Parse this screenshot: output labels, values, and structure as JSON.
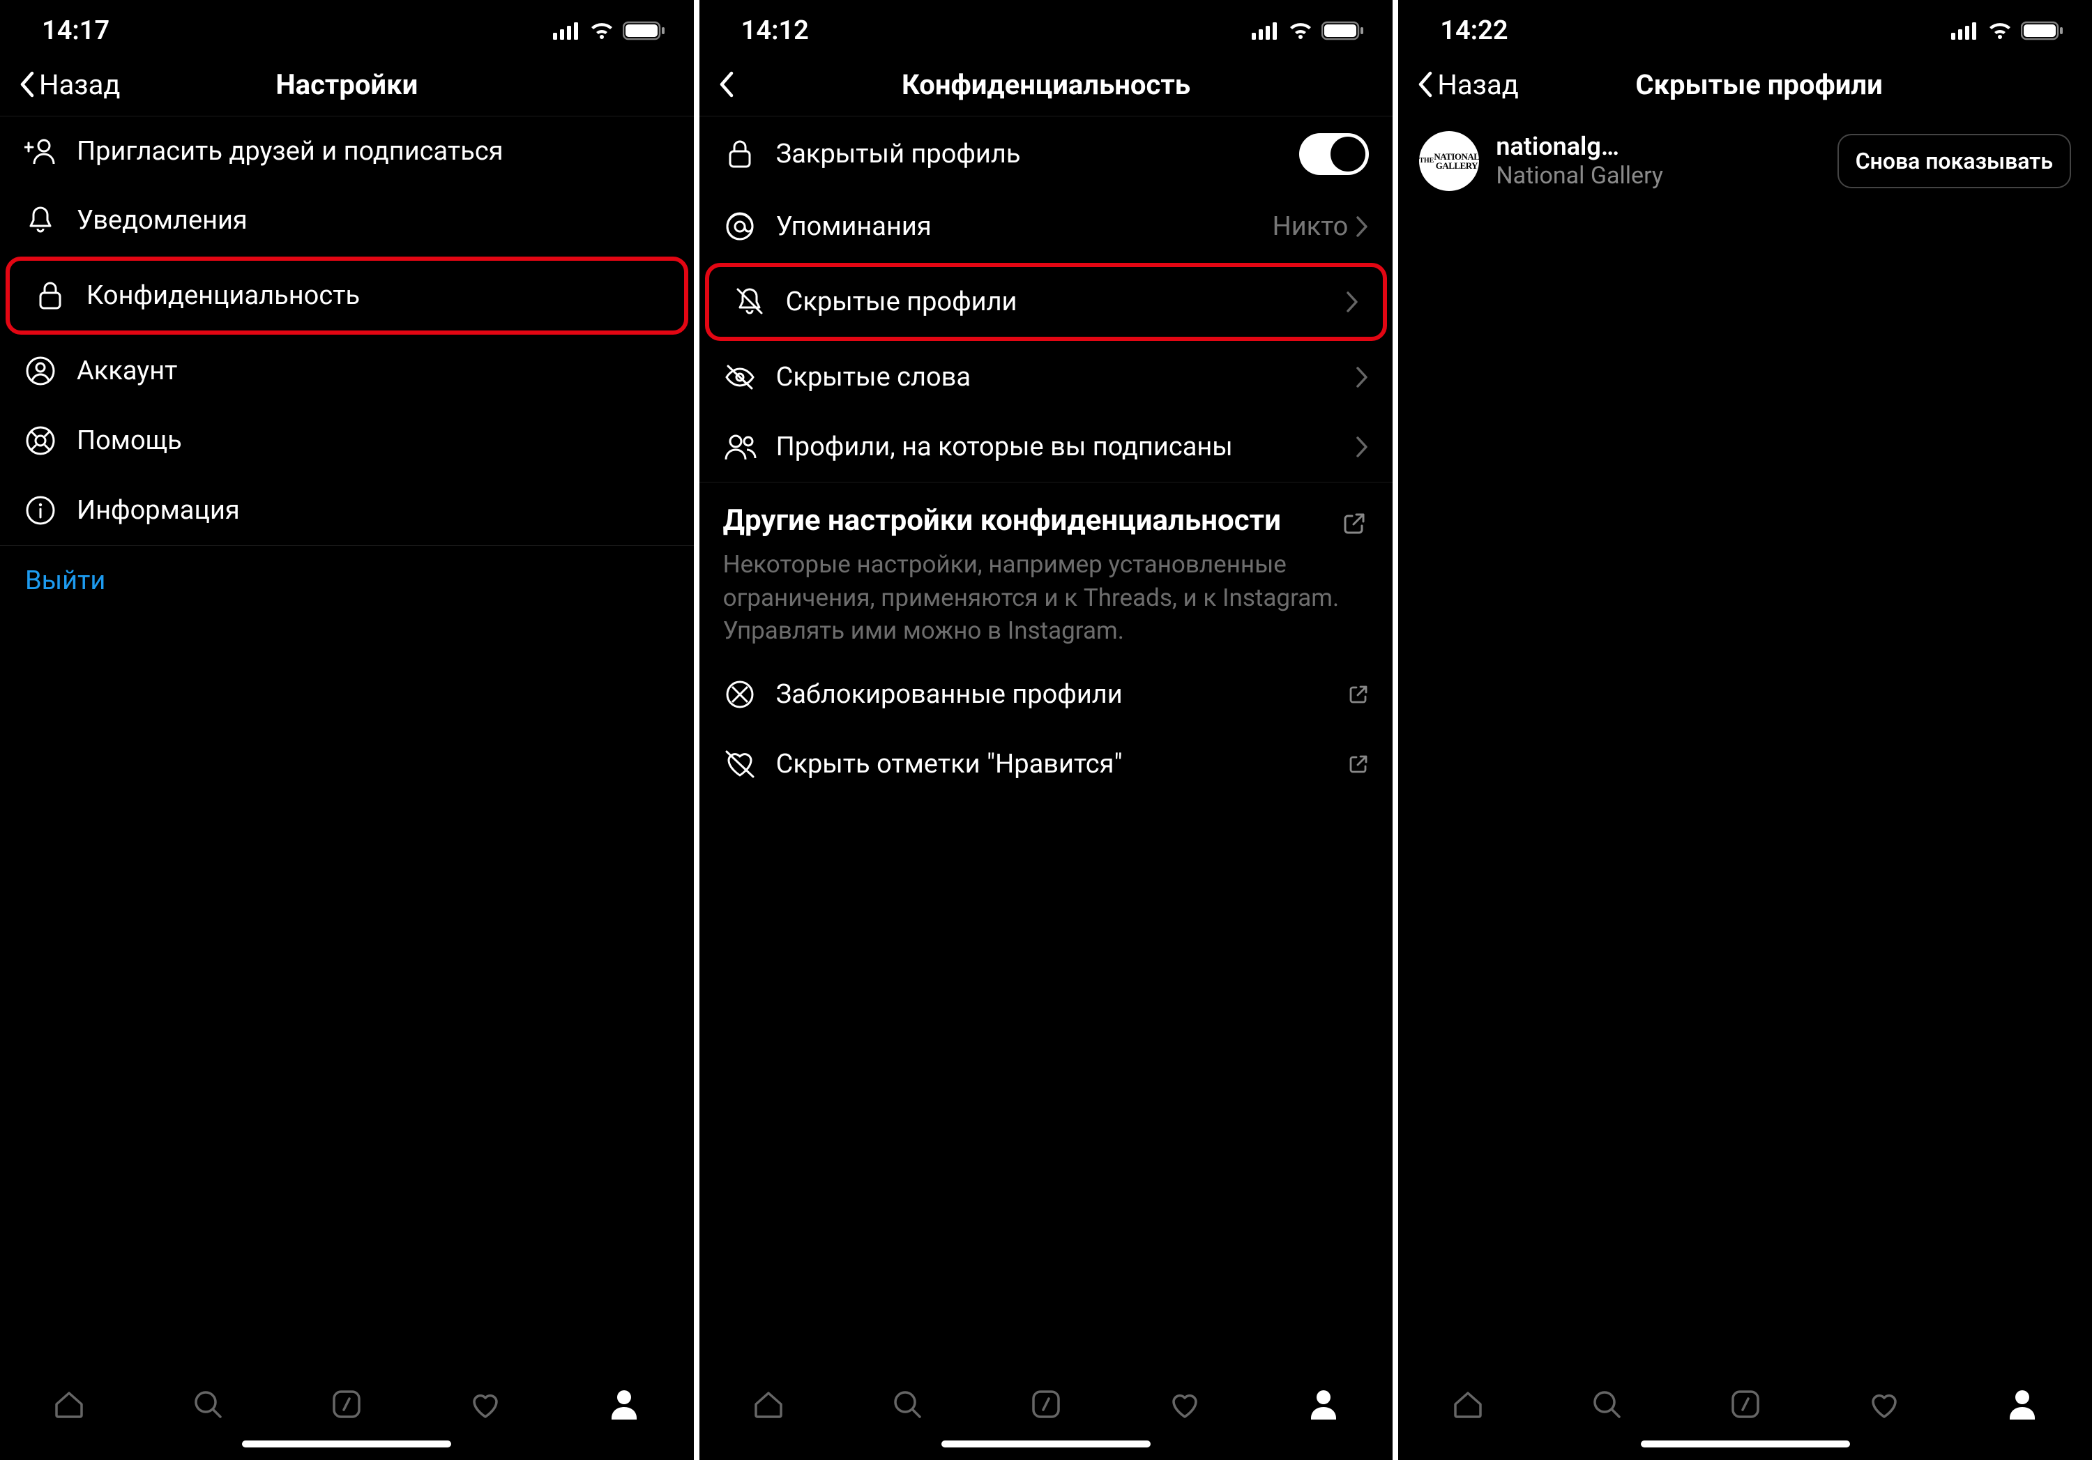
{
  "colors": {
    "accent": "#1d9bf0",
    "highlight": "#e30613",
    "muted": "#6d6d6d"
  },
  "screen1": {
    "status_time": "14:17",
    "back_label": "Назад",
    "title": "Настройки",
    "items": [
      {
        "label": "Пригласить друзей и подписаться",
        "icon": "add-user"
      },
      {
        "label": "Уведомления",
        "icon": "bell"
      },
      {
        "label": "Конфиденциальность",
        "icon": "lock",
        "highlight": true
      },
      {
        "label": "Аккаунт",
        "icon": "user-circle"
      },
      {
        "label": "Помощь",
        "icon": "life-ring"
      },
      {
        "label": "Информация",
        "icon": "info"
      }
    ],
    "logout": "Выйти"
  },
  "screen2": {
    "status_time": "14:12",
    "title": "Конфиденциальность",
    "rows": {
      "private_profile": "Закрытый профиль",
      "mentions": {
        "label": "Упоминания",
        "value": "Никто"
      },
      "hidden_profiles": "Скрытые профили",
      "hidden_words": "Скрытые слова",
      "profiles_followed": "Профили, на которые вы подписаны"
    },
    "section": {
      "title": "Другие настройки конфиденциальности",
      "desc": "Некоторые настройки, например установленные ограничения, применяются и к Threads, и к Instagram. Управлять ими можно в Instagram."
    },
    "extra_rows": {
      "blocked": "Заблокированные профили",
      "hide_likes": "Скрыть отметки \"Нравится\""
    }
  },
  "screen3": {
    "status_time": "14:22",
    "back_label": "Назад",
    "title": "Скрытые профили",
    "profile": {
      "username": "nationalg…",
      "fullname": "National Gallery",
      "avatar_text": "THE NATIONAL GALLERY",
      "action": "Снова показывать"
    }
  }
}
